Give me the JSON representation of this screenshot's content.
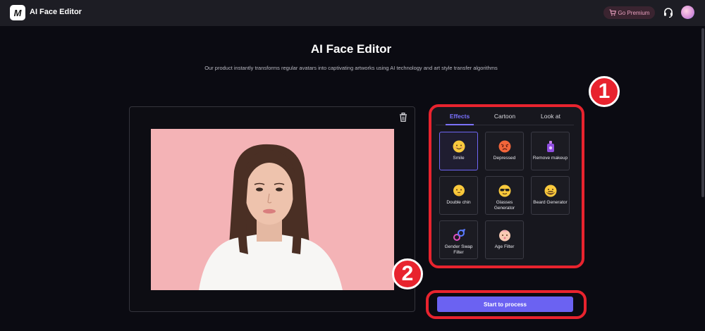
{
  "app": {
    "logo_letter": "M",
    "title": "AI Face Editor"
  },
  "topbar": {
    "premium_label": "Go Premium"
  },
  "main": {
    "title": "AI Face Editor",
    "subtitle": "Our product instantly transforms regular avatars into captivating artworks using AI technology and art style transfer algorithms"
  },
  "tabs": [
    {
      "label": "Effects",
      "active": true
    },
    {
      "label": "Cartoon",
      "active": false
    },
    {
      "label": "Look at",
      "active": false
    }
  ],
  "effects": [
    {
      "label": "Smile",
      "icon": "smile-emoji-icon",
      "selected": true
    },
    {
      "label": "Depressed",
      "icon": "angry-emoji-icon",
      "selected": false
    },
    {
      "label": "Remove makeup",
      "icon": "makeup-bottle-icon",
      "selected": false
    },
    {
      "label": "Double chin",
      "icon": "double-chin-emoji-icon",
      "selected": false
    },
    {
      "label": "Glasses Generator",
      "icon": "sunglasses-emoji-icon",
      "selected": false
    },
    {
      "label": "Beard Generator",
      "icon": "beard-emoji-icon",
      "selected": false
    },
    {
      "label": "Gender Swap Filter",
      "icon": "gender-swap-icon",
      "selected": false
    },
    {
      "label": "Age Filter",
      "icon": "baby-face-icon",
      "selected": false
    }
  ],
  "badges": {
    "first": "1",
    "second": "2"
  },
  "process_label": "Start to process",
  "colors": {
    "accent": "#6b62f2",
    "highlight": "#e8232e",
    "background": "#0b0b12"
  }
}
